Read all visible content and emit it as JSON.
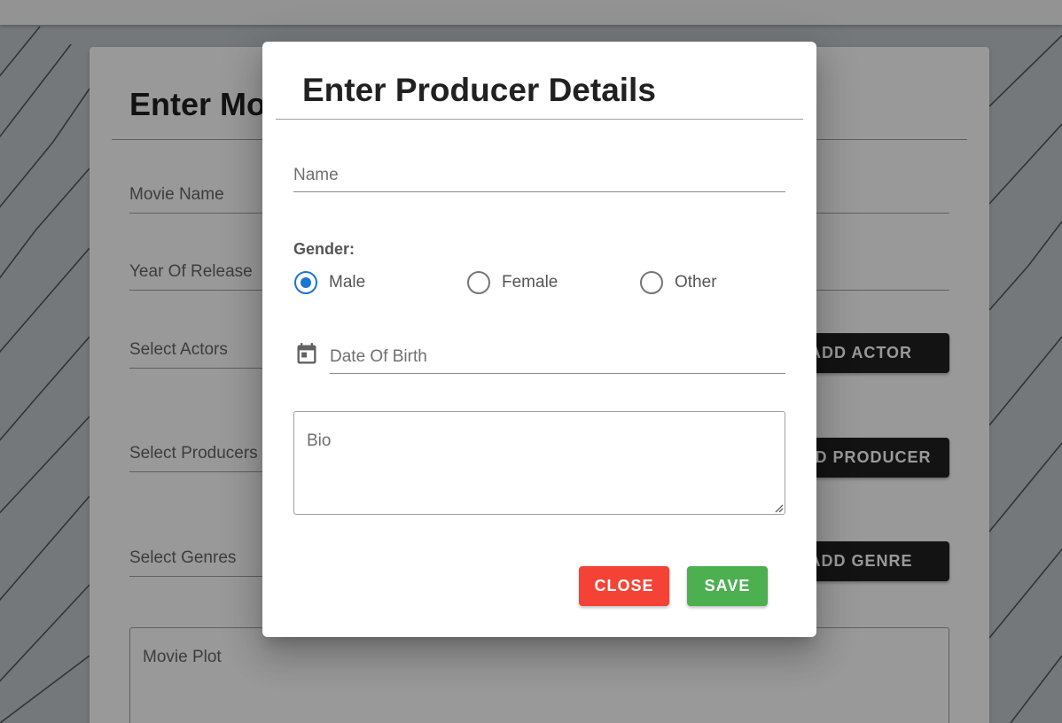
{
  "background_form": {
    "title": "Enter Movie Details",
    "fields": {
      "movie_name": "Movie Name",
      "year_of_release": "Year Of Release",
      "select_actors": "Select Actors",
      "select_producers": "Select Producers",
      "select_genres": "Select Genres",
      "movie_plot": "Movie Plot"
    },
    "buttons": {
      "add_actor": "ADD ACTOR",
      "add_producer": "ADD PRODUCER",
      "add_genre": "ADD GENRE"
    }
  },
  "dialog": {
    "title": "Enter Producer Details",
    "name_placeholder": "Name",
    "gender": {
      "label": "Gender:",
      "options": [
        "Male",
        "Female",
        "Other"
      ],
      "selected": "Male"
    },
    "dob_placeholder": "Date Of Birth",
    "dob_icon": "calendar-icon",
    "bio_placeholder": "Bio",
    "buttons": {
      "close": "CLOSE",
      "save": "SAVE"
    }
  },
  "colors": {
    "radio_selected": "#1976d2",
    "close_button": "#f44336",
    "save_button": "#4caf50",
    "secondary_button": "#212121"
  }
}
